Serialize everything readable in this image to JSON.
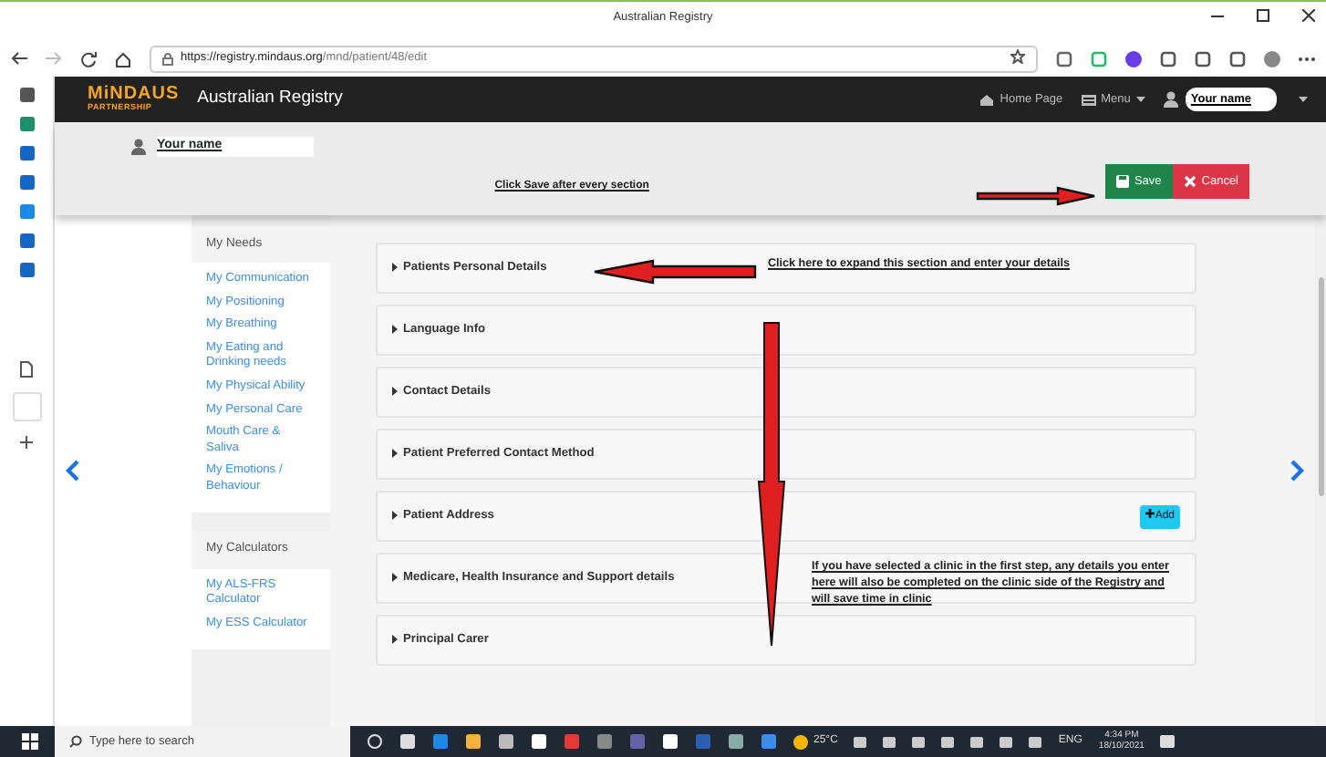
{
  "window": {
    "title": "Australian Registry"
  },
  "browser": {
    "url_host": "https://registry.mindaus.org",
    "url_path": "/mnd/patient/48/edit"
  },
  "navbar": {
    "logo_top": "MiNDAUS",
    "logo_bottom": "PARTNERSHIP",
    "title": "Australian Registry",
    "links": [
      {
        "label": "Home Page",
        "kind": "home"
      },
      {
        "label": "Menu",
        "kind": "menu"
      }
    ],
    "user": "Your name"
  },
  "header": {
    "user": "Your name",
    "hint": "Click Save after every section",
    "buttons": [
      {
        "label": "Save",
        "kind": "save"
      },
      {
        "label": "Cancel",
        "kind": "cancel"
      }
    ]
  },
  "sidebar": [
    {
      "title": "My Needs",
      "items": [
        "My Communication",
        "My Positioning",
        "My Breathing",
        "My Eating and Drinking needs",
        "My Physical Ability",
        "My Personal Care",
        "Mouth Care & Saliva",
        "My Emotions / Behaviour"
      ]
    },
    {
      "title": "My Calculators",
      "items": [
        "My ALS-FRS Calculator",
        "My ESS Calculator"
      ]
    }
  ],
  "sections": [
    {
      "title": "Patients Personal Details"
    },
    {
      "title": "Language Info"
    },
    {
      "title": "Contact Details"
    },
    {
      "title": "Patient Preferred Contact Method"
    },
    {
      "title": "Patient Address",
      "button": "Add"
    },
    {
      "title": "Medicare, Health Insurance and Support details"
    },
    {
      "title": "Principal Carer"
    }
  ],
  "callouts": [
    {
      "kind": "expand",
      "text": "Click here to expand this section and enter your details"
    },
    {
      "kind": "clinic",
      "text": "If you have selected a clinic in the first step, any details you enter here will also be completed on the clinic side of the Registry and will save time in clinic"
    }
  ],
  "taskbar": {
    "search_placeholder": "Type here to search",
    "temperature": "25°C",
    "language": "ENG",
    "time": "4:34 PM",
    "date": "18/10/2021"
  }
}
